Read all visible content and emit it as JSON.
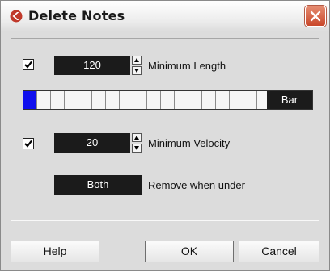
{
  "window": {
    "title": "Delete Notes"
  },
  "min_length": {
    "enabled": true,
    "value": "120",
    "label": "Minimum Length"
  },
  "length_bar": {
    "selected_cells": 1,
    "label": "Bar"
  },
  "min_velocity": {
    "enabled": true,
    "value": "20",
    "label": "Minimum Velocity"
  },
  "remove": {
    "value": "Both",
    "label": "Remove when under"
  },
  "buttons": {
    "help": "Help",
    "ok": "OK",
    "cancel": "Cancel"
  },
  "colors": {
    "accent": "#1010ee",
    "logo": "#c0392b",
    "field_bg": "#1b1b1b",
    "close_bg": "#c9472a"
  }
}
